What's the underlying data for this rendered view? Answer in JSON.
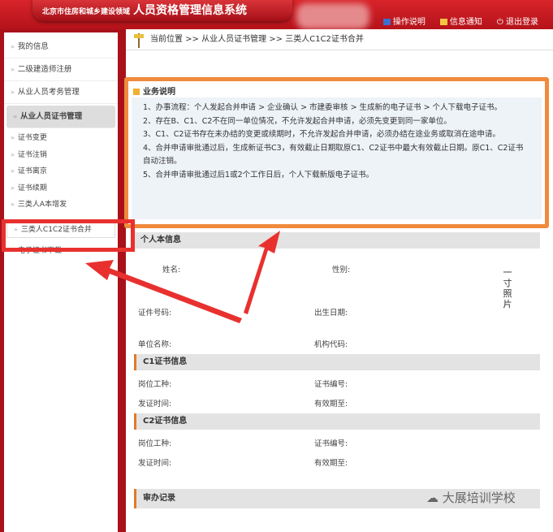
{
  "header": {
    "org": "北京市住房和城乡建设领域",
    "title": "人员资格管理信息系统",
    "links": [
      "操作说明",
      "信息通知",
      "退出登录"
    ]
  },
  "sidebar": {
    "items": [
      "我的信息",
      "二级建造师注册",
      "从业人员考务管理",
      "从业人员证书管理"
    ],
    "subitems": [
      "证书变更",
      "证书注销",
      "证书离京",
      "证书续期",
      "三类人A本增发"
    ],
    "selected": "三类人C1C2证书合并",
    "after": "电子证书下载"
  },
  "breadcrumb": "当前位置 >> 从业人员证书管理 >> 三类人C1C2证书合并",
  "notice": {
    "title": "业务说明",
    "lines": [
      "1、办事流程：个人发起合并申请 > 企业确认 > 市建委审核 > 生成新的电子证书 > 个人下载电子证书。",
      "2、存在B、C1、C2不在同一单位情况，不允许发起合并申请，必须先变更到同一家单位。",
      "3、C1、C2证书存在未办结的变更或续期时，不允许发起合并申请，必须办结在途业务或取消在途申请。",
      "4、合并申请审批通过后，生成新证书C3，有效截止日期取原C1、C2证书中最大有效截止日期。原C1、C2证书自动注销。",
      "5、合并申请审批通过后1或2个工作日后，个人下载新版电子证书。"
    ]
  },
  "personal": {
    "title": "个人本信息",
    "name": "姓名:",
    "gender": "性别:",
    "id": "证件号码:",
    "birth": "出生日期:",
    "unit": "单位名称:",
    "orgcode": "机构代码:",
    "photo": "一寸照片"
  },
  "c1": {
    "title": "C1证书信息",
    "post": "岗位工种:",
    "certno": "证书编号:",
    "issued": "发证时间:",
    "valid": "有效期至:"
  },
  "c2": {
    "title": "C2证书信息",
    "post": "岗位工种:",
    "certno": "证书编号:",
    "issued": "发证时间:",
    "valid": "有效期至:"
  },
  "records": {
    "title": "审办记录"
  },
  "watermark": "大展培训学校",
  "colors": {
    "header": "#c81c22",
    "highlight": "#f08a3c",
    "annotation": "#e8312f"
  }
}
